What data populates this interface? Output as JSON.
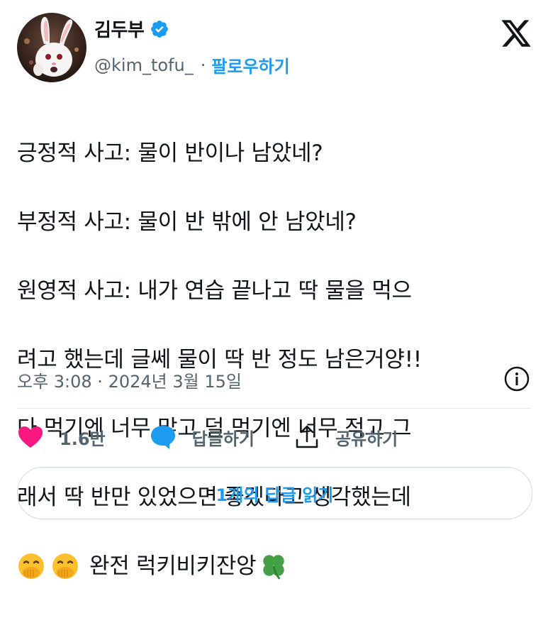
{
  "author": {
    "display_name": "김두부",
    "handle": "@kim_tofu_",
    "follow_label": "팔로우하기",
    "separator": "·"
  },
  "tweet": {
    "lines": [
      "긍정적 사고: 물이 반이나 남았네?",
      "부정적 사고: 물이 반 밖에 안 남았네?",
      "원영적 사고: 내가 연습 끝나고 딱 물을 먹으",
      "려고 했는데 글쎄 물이 딱 반 정도 남은거양!!",
      "다 먹기엔 너무 많고 덜 먹기엔 너무 적고 그",
      "래서 딱 반만 있었으면 좋겠다고 생각했는데"
    ],
    "last_line_text": "완전 럭키비키잔앙"
  },
  "timestamp": "오후 3:08 · 2024년 3월 15일",
  "actions": {
    "likes": "1.6만",
    "reply_label": "답글하기",
    "share_label": "공유하기"
  },
  "read_replies_label": "1개의 답글 읽기",
  "colors": {
    "accent": "#1d9bf0",
    "muted": "#536471",
    "heart": "#f91880"
  },
  "icons": [
    "verified-badge-icon",
    "x-logo-icon",
    "info-icon",
    "heart-icon",
    "reply-bubble-icon",
    "share-icon",
    "face-with-hand-over-mouth-emoji",
    "four-leaf-clover-emoji"
  ]
}
